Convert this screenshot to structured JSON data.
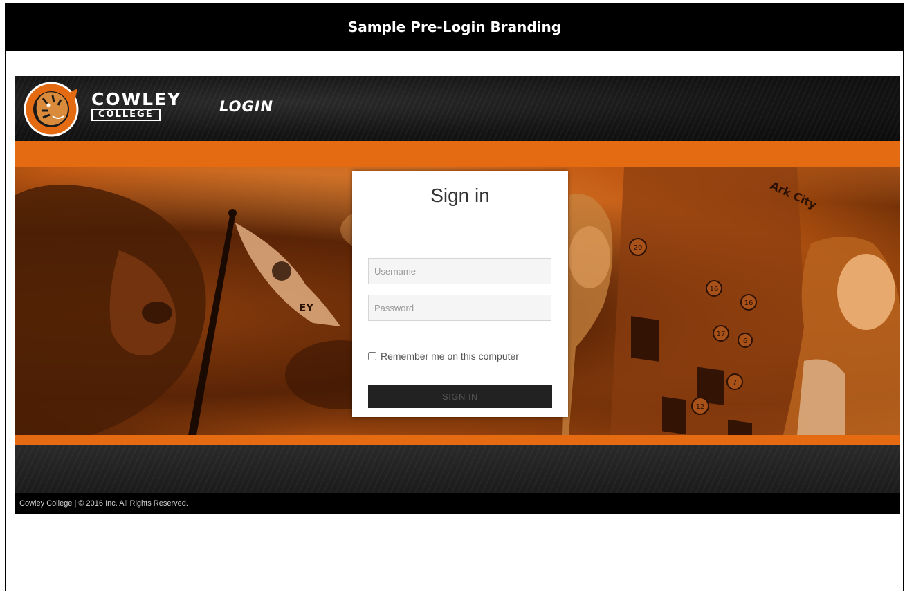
{
  "page": {
    "title": "Sample Pre-Login Branding"
  },
  "header": {
    "brand_top": "COWLEY",
    "brand_bottom": "COLLEGE",
    "login_label": "LOGIN"
  },
  "signin": {
    "title": "Sign in",
    "username_placeholder": "Username",
    "password_placeholder": "Password",
    "remember_label": "Remember me on this computer",
    "remember_checked": false,
    "button_label": "SIGN IN"
  },
  "footer": {
    "text": "Cowley College | © 2016 Inc. All Rights Reserved."
  },
  "colors": {
    "accent_orange": "#e46b12",
    "title_bar": "#000000",
    "button": "#222222"
  },
  "hero": {
    "flag_text": "EY",
    "sign_text": "Ark City",
    "sign_numbers": [
      "20",
      "16",
      "16",
      "17",
      "6",
      "7",
      "12"
    ]
  }
}
